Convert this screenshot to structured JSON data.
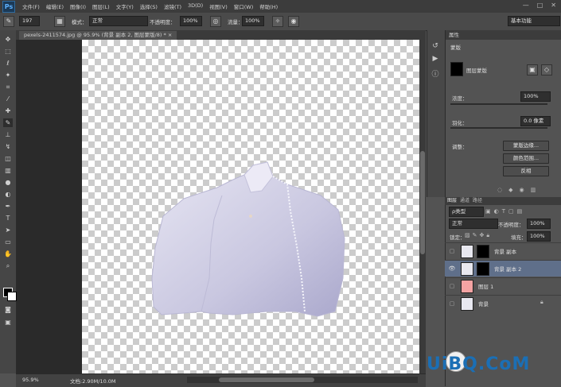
{
  "app": {
    "logo": "Ps",
    "window_controls": [
      "—",
      "□",
      "✕"
    ]
  },
  "menu": [
    "文件(F)",
    "编辑(E)",
    "图像(I)",
    "图层(L)",
    "文字(Y)",
    "选择(S)",
    "滤镜(T)",
    "3D(D)",
    "视图(V)",
    "窗口(W)",
    "帮助(H)"
  ],
  "options": {
    "brush_size": "197",
    "mode_label": "模式：",
    "mode_value": "正常",
    "opacity_label": "不透明度：",
    "opacity_value": "100%",
    "flow_label": "流量：",
    "flow_value": "100%",
    "workspace": "基本功能"
  },
  "document": {
    "tab": "pexels-2411574.jpg @ 95.9% (背景 副本 2, 图层蒙版/8) *",
    "close": "×"
  },
  "status": {
    "zoom": "95.9%",
    "doc": "文档:2.90M/10.0M"
  },
  "properties": {
    "tab": "属性",
    "section": "蒙版",
    "mask_label": "图层蒙版",
    "density_label": "浓度：",
    "density_value": "100%",
    "feather_label": "羽化：",
    "feather_value": "0.0 像素",
    "adjust_label": "调整：",
    "edge_button": "蒙版边缘...",
    "color_range_button": "颜色范围...",
    "invert_button": "反相"
  },
  "layers": {
    "tabs": [
      "图层",
      "通道",
      "路径"
    ],
    "filter": "ρ类型",
    "blend_mode": "正常",
    "opacity_label": "不透明度：",
    "opacity_value": "100%",
    "lock_label": "锁定：",
    "fill_label": "填充：",
    "fill_value": "100%",
    "items": [
      {
        "name": "背景 副本",
        "visible": false,
        "has_mask": true
      },
      {
        "name": "背景 副本 2",
        "visible": true,
        "has_mask": true,
        "selected": true
      },
      {
        "name": "图层 1",
        "visible": false,
        "has_mask": false,
        "color": "#f4a3a3"
      },
      {
        "name": "背景",
        "visible": false,
        "has_mask": false,
        "locked": true
      }
    ]
  },
  "watermark": "UiBQ.CoM",
  "colors": {
    "selected_layer": "#5f6f8a",
    "canvas_accent": "#1b6fb5"
  }
}
